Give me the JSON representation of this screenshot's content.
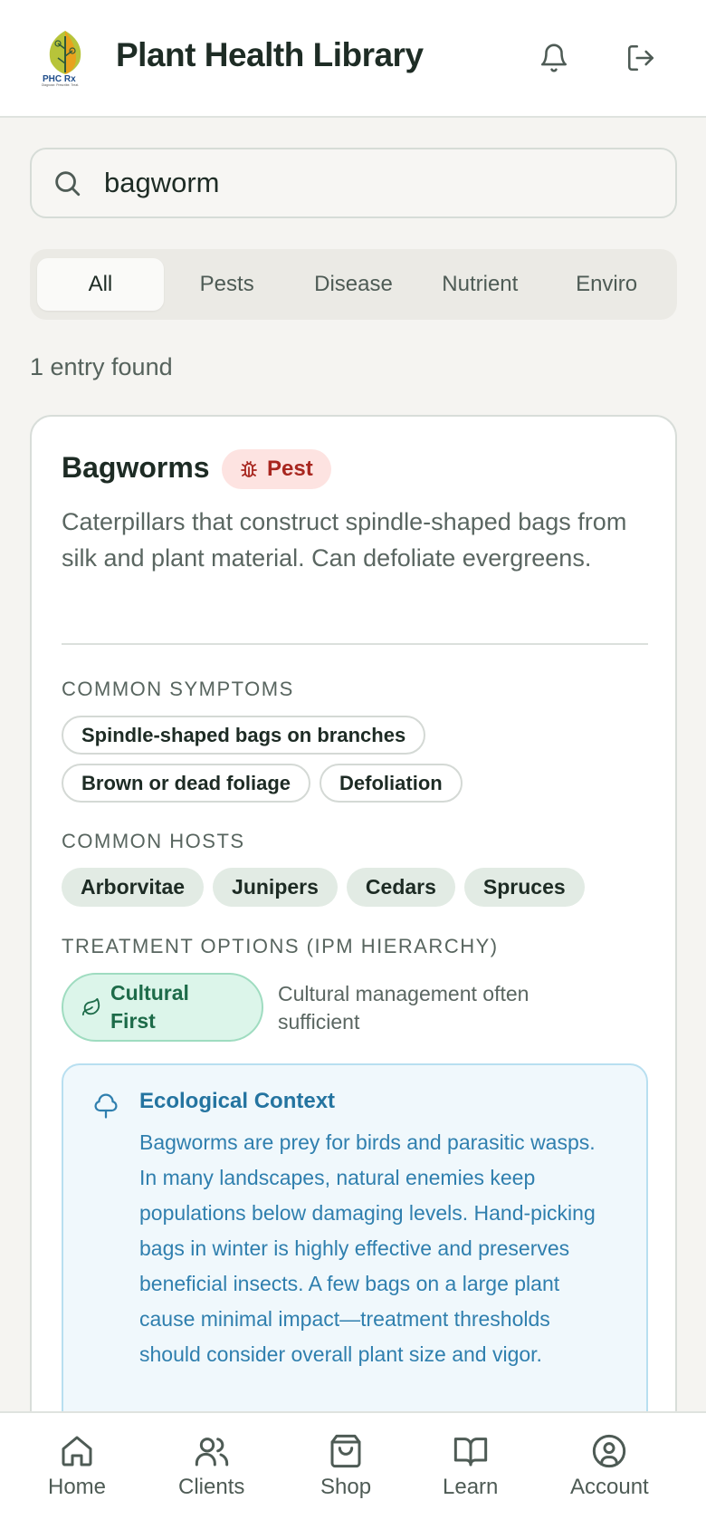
{
  "header": {
    "title": "Plant Health Library",
    "logo_text": "PHC Rx",
    "logo_tagline": "Diagnose. Prescribe. Treat."
  },
  "search": {
    "value": "bagworm",
    "placeholder": "Search"
  },
  "tabs": [
    {
      "label": "All",
      "active": true
    },
    {
      "label": "Pests",
      "active": false
    },
    {
      "label": "Disease",
      "active": false
    },
    {
      "label": "Nutrient",
      "active": false
    },
    {
      "label": "Enviro",
      "active": false
    }
  ],
  "results": {
    "count_text": "1 entry found"
  },
  "entry": {
    "title": "Bagworms",
    "badge": "Pest",
    "description": "Caterpillars that construct spindle-shaped bags from silk and plant material. Can defoliate evergreens.",
    "symptoms_label": "COMMON SYMPTOMS",
    "symptoms": [
      "Spindle-shaped bags on branches",
      "Brown or dead foliage",
      "Defoliation"
    ],
    "hosts_label": "COMMON HOSTS",
    "hosts": [
      "Arborvitae",
      "Junipers",
      "Cedars",
      "Spruces"
    ],
    "treatment_label": "TREATMENT OPTIONS (IPM HIERARCHY)",
    "treatment_badge": "Cultural First",
    "treatment_note": "Cultural management often sufficient",
    "eco_title": "Ecological Context",
    "eco_text": "Bagworms are prey for birds and parasitic wasps. In many landscapes, natural enemies keep populations below damaging levels. Hand-picking bags in winter is highly effective and preserves beneficial insects. A few bags on a large plant cause minimal impact—treatment thresholds should consider overall plant size and vigor."
  },
  "nav": [
    {
      "label": "Home",
      "icon": "home-icon"
    },
    {
      "label": "Clients",
      "icon": "users-icon"
    },
    {
      "label": "Shop",
      "icon": "shopping-bag-icon"
    },
    {
      "label": "Learn",
      "icon": "book-icon"
    },
    {
      "label": "Account",
      "icon": "user-circle-icon"
    }
  ],
  "colors": {
    "pest_badge_bg": "#fde3e1",
    "pest_badge_text": "#a8261f",
    "cultural_bg": "#dcf5ea",
    "eco_text": "#2f7fae"
  }
}
